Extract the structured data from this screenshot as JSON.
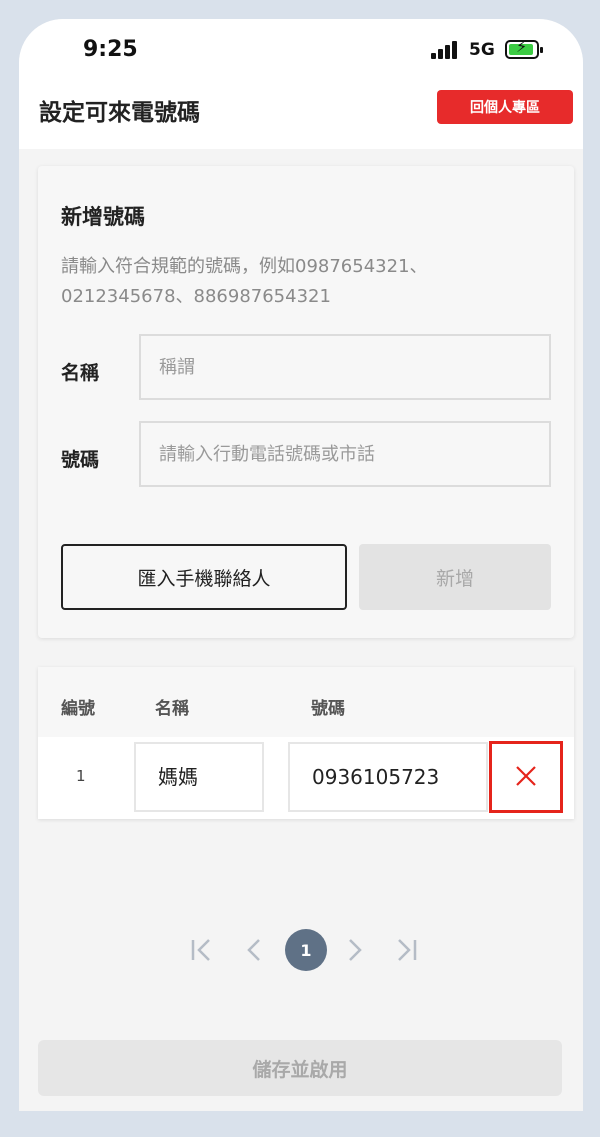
{
  "status_bar": {
    "time": "9:25",
    "network": "5G"
  },
  "header": {
    "title": "設定可來電號碼",
    "profile_button": "回個人專區"
  },
  "add_form": {
    "title": "新增號碼",
    "hint": "請輸入符合規範的號碼，例如0987654321、0212345678、886987654321",
    "name_label": "名稱",
    "name_placeholder": "稱謂",
    "number_label": "號碼",
    "number_placeholder": "請輸入行動電話號碼或市話",
    "import_button": "匯入手機聯絡人",
    "add_button": "新增"
  },
  "table": {
    "headers": [
      "編號",
      "名稱",
      "號碼"
    ],
    "rows": [
      {
        "index": "1",
        "name": "媽媽",
        "number": "0936105723"
      }
    ]
  },
  "pagination": {
    "current": "1"
  },
  "footer": {
    "save_button": "儲存並啟用"
  },
  "colors": {
    "accent_red": "#e72b2b",
    "page_active": "#5f7186",
    "disabled_gray": "#e3e3e3"
  },
  "icons": [
    "first-page-icon",
    "prev-page-icon",
    "next-page-icon",
    "last-page-icon",
    "delete-x-icon"
  ]
}
